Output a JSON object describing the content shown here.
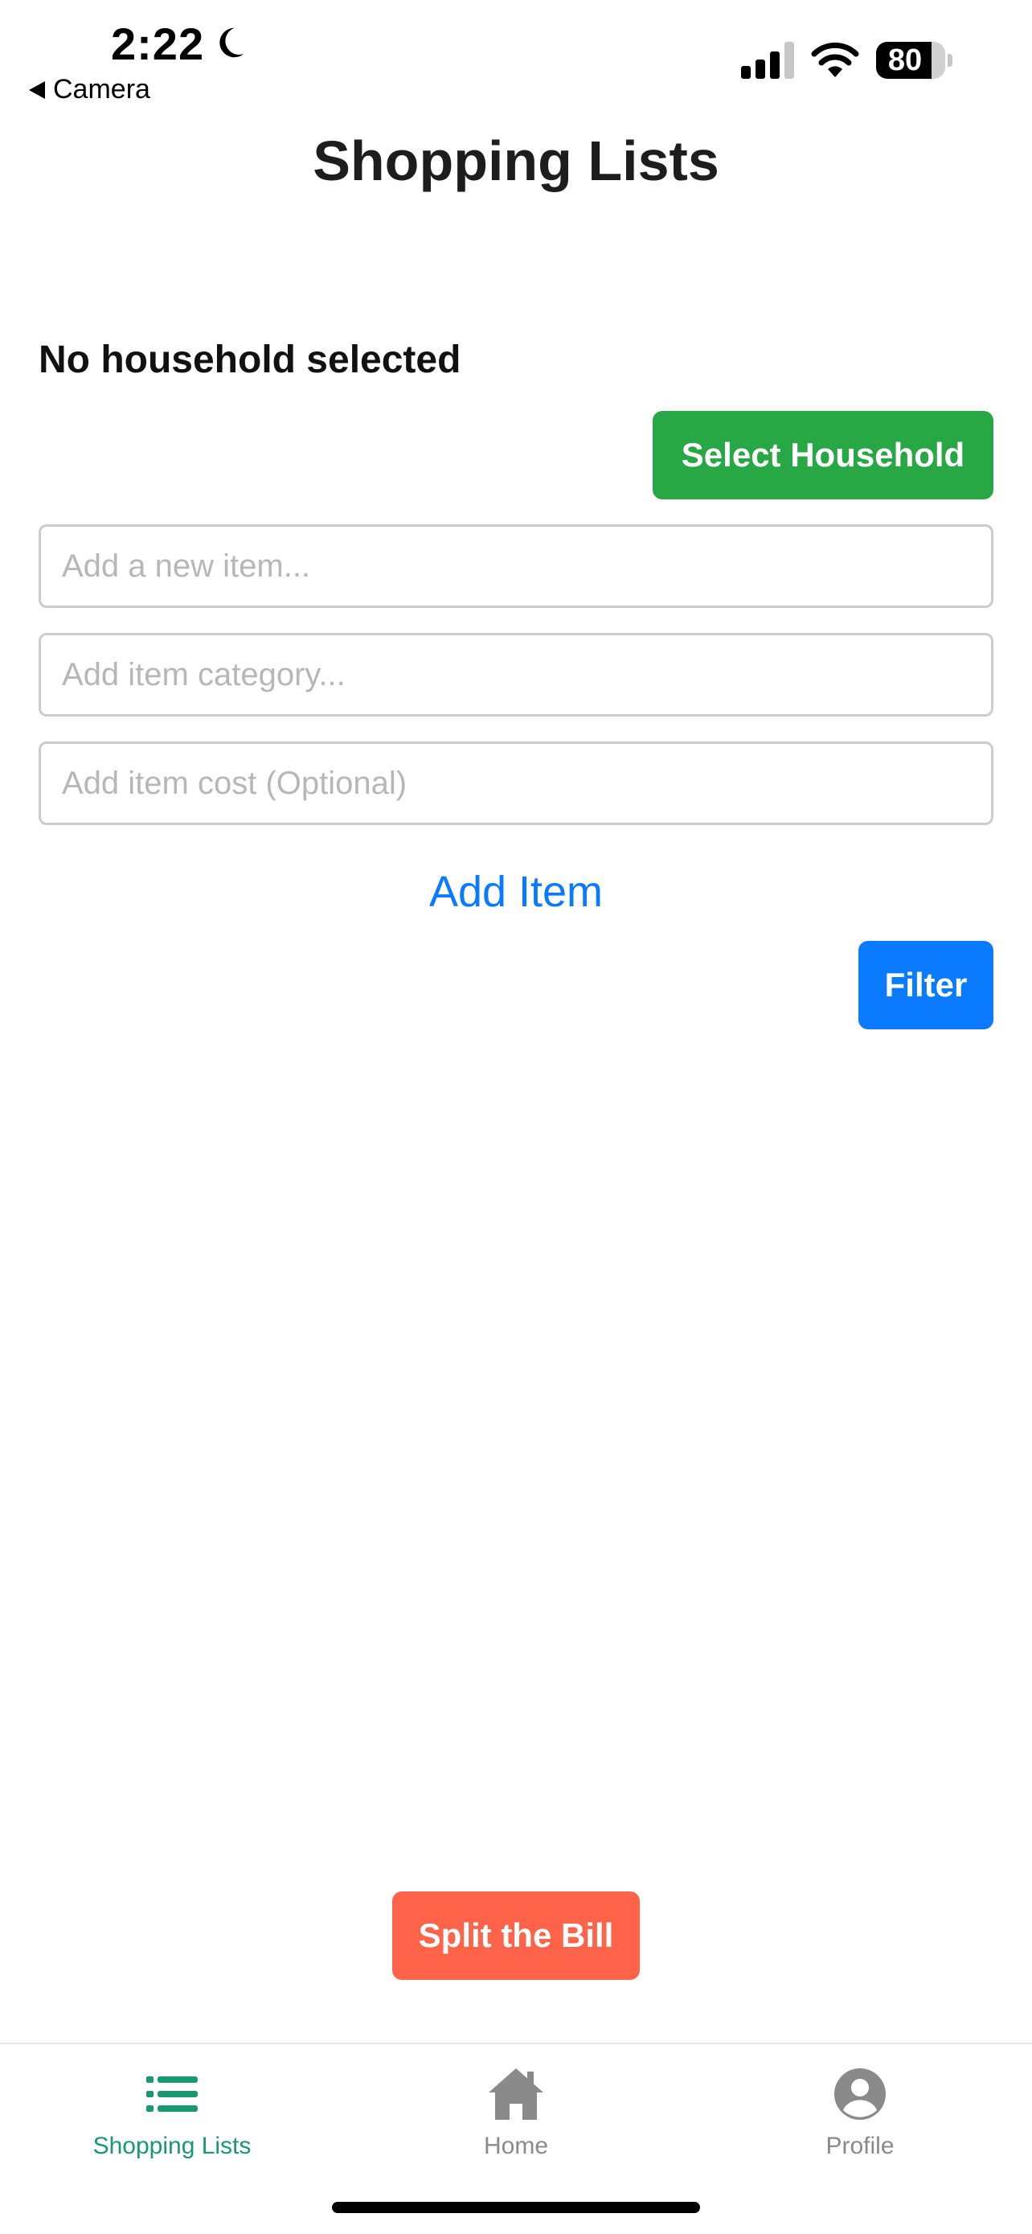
{
  "status_bar": {
    "time": "2:22",
    "back_label": "Camera",
    "battery_level": "80",
    "battery_fraction": 0.8,
    "icons": [
      "moon-icon",
      "cellular-signal-icon",
      "wifi-icon",
      "battery-icon"
    ]
  },
  "header": {
    "title": "Shopping Lists"
  },
  "household": {
    "status_text": "No household selected",
    "select_button_label": "Select Household",
    "select_button_color": "#28a745"
  },
  "form": {
    "item_placeholder": "Add a new item...",
    "item_value": "",
    "category_placeholder": "Add item category...",
    "category_value": "",
    "cost_placeholder": "Add item cost (Optional)",
    "cost_value": "",
    "add_item_label": "Add Item",
    "link_color": "#0a7aff"
  },
  "filter_button_label": "Filter",
  "filter_button_color": "#0a7aff",
  "split_bill_label": "Split the Bill",
  "split_bill_color": "#ff634a",
  "tab_bar": {
    "active_color": "#1a9970",
    "inactive_color": "#8a8a8a",
    "tabs": [
      {
        "label": "Shopping Lists",
        "icon": "list-icon",
        "active": true
      },
      {
        "label": "Home",
        "icon": "home-icon",
        "active": false
      },
      {
        "label": "Profile",
        "icon": "profile-icon",
        "active": false
      }
    ]
  }
}
